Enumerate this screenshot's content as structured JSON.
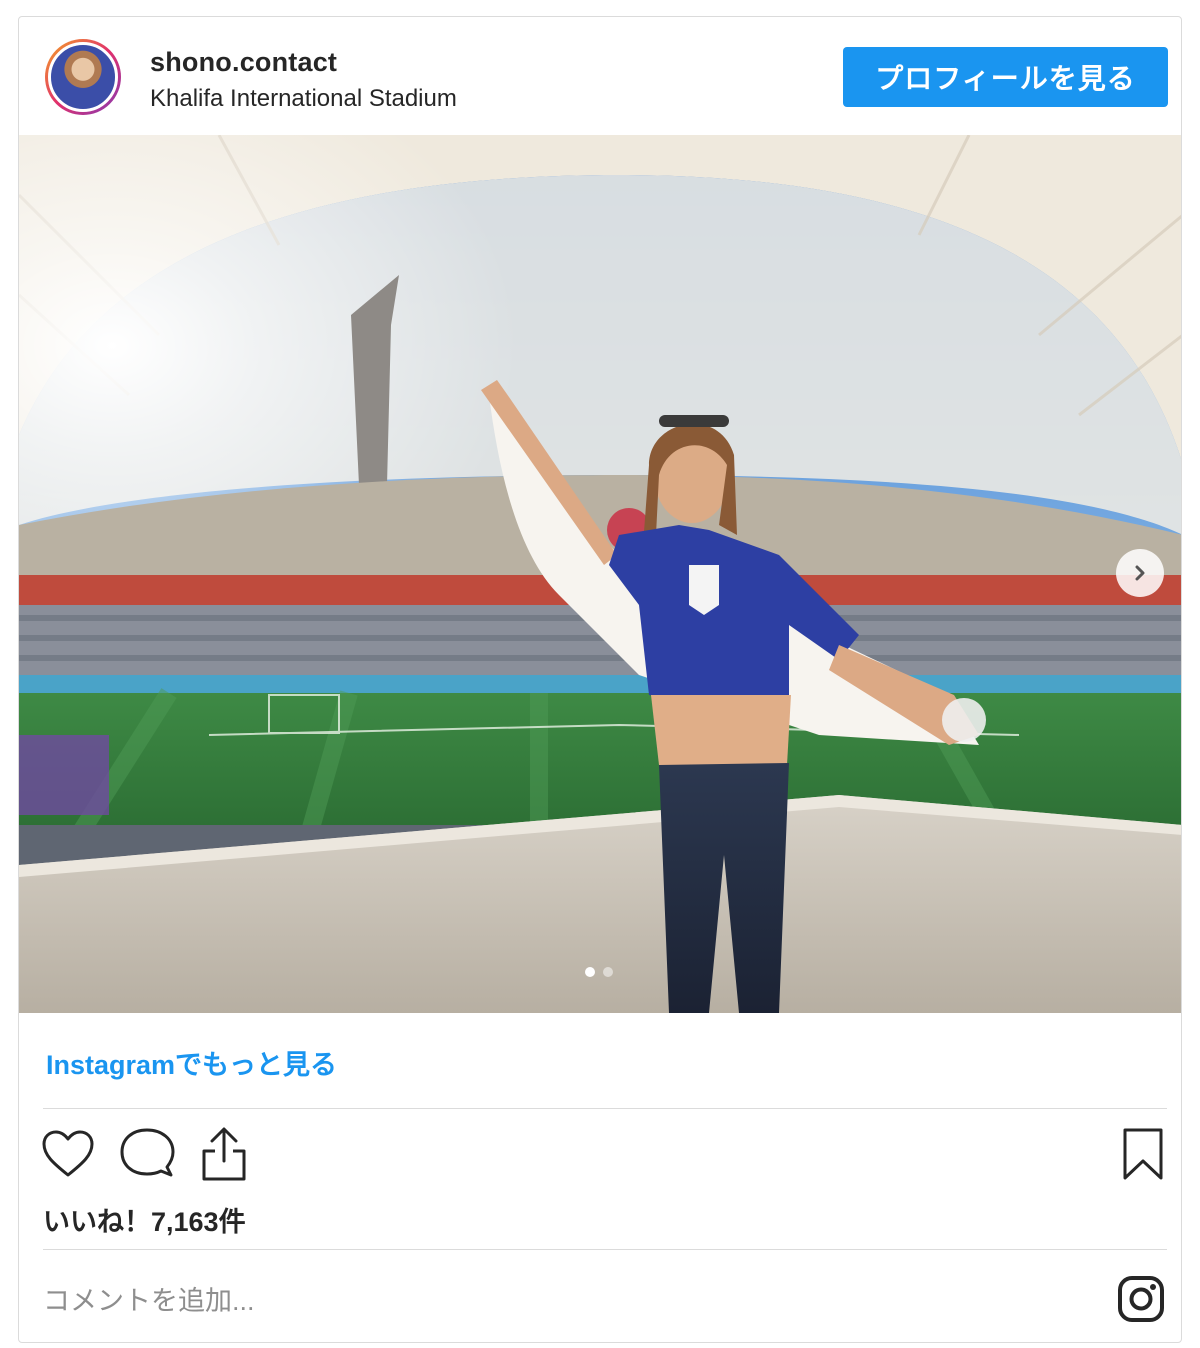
{
  "header": {
    "username": "shono.contact",
    "location": "Khalifa International Stadium",
    "profile_button_label": "プロフィールを見る"
  },
  "media": {
    "slide_count": 2,
    "active_slide": 1
  },
  "footer": {
    "more_link": "Instagramでもっと見る",
    "likes_text": "いいね！7,163件",
    "comment_placeholder": "コメントを追加..."
  },
  "colors": {
    "accent": "#1a95f0",
    "border": "#dbdbdb"
  },
  "icons": [
    "heart-icon",
    "comment-icon",
    "share-icon",
    "bookmark-icon",
    "instagram-icon",
    "chevron-right-icon"
  ]
}
